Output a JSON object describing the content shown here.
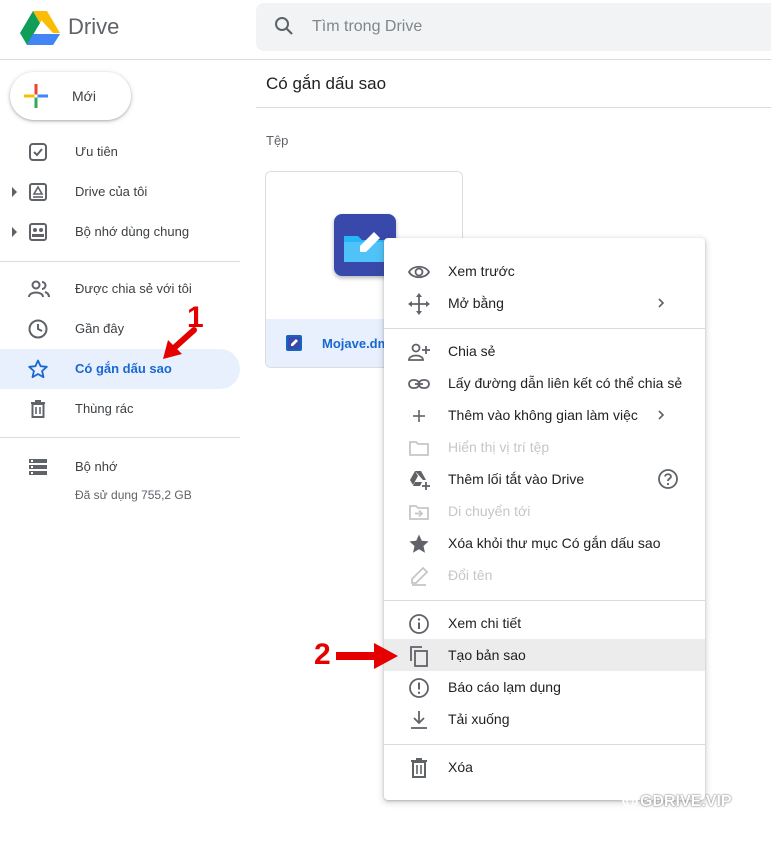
{
  "header": {
    "brand": "Drive",
    "search_placeholder": "Tìm trong Drive"
  },
  "new_button": {
    "label": "Mới"
  },
  "sidebar": {
    "items": [
      {
        "label": "Ưu tiên",
        "icon": "priority-check-icon"
      },
      {
        "label": "Drive của tôi",
        "icon": "my-drive-icon"
      },
      {
        "label": "Bộ nhớ dùng chung",
        "icon": "shared-drives-icon"
      },
      {
        "label": "Được chia sẻ với tôi",
        "icon": "shared-with-me-icon"
      },
      {
        "label": "Gần đây",
        "icon": "clock-icon"
      },
      {
        "label": "Có gắn dấu sao",
        "icon": "star-icon",
        "active": true
      },
      {
        "label": "Thùng rác",
        "icon": "trash-icon"
      }
    ],
    "storage": {
      "label": "Bộ nhớ",
      "used": "Đã sử dụng 755,2 GB"
    }
  },
  "main": {
    "title": "Có gắn dấu sao",
    "section": "Tệp",
    "file": {
      "name": "Mojave.dm"
    }
  },
  "context_menu": {
    "items": [
      {
        "label": "Xem trước",
        "icon": "eye-icon"
      },
      {
        "label": "Mở bằng",
        "icon": "move-arrows-icon",
        "submenu": true
      },
      {
        "label": "Chia sẻ",
        "icon": "add-person-icon"
      },
      {
        "label": "Lấy đường dẫn liên kết có thể chia sẻ",
        "icon": "link-icon"
      },
      {
        "label": "Thêm vào không gian làm việc",
        "icon": "plus-icon",
        "submenu": true
      },
      {
        "label": "Hiển thị vị trí tệp",
        "icon": "folder-icon",
        "disabled": true
      },
      {
        "label": "Thêm lối tắt vào Drive",
        "icon": "drive-shortcut-icon",
        "help": true
      },
      {
        "label": "Di chuyển tới",
        "icon": "move-to-folder-icon",
        "disabled": true
      },
      {
        "label": "Xóa khỏi thư mục Có gắn dấu sao",
        "icon": "star-filled-icon"
      },
      {
        "label": "Đổi tên",
        "icon": "pencil-icon",
        "disabled": true
      },
      {
        "label": "Xem chi tiết",
        "icon": "info-icon"
      },
      {
        "label": "Tạo bản sao",
        "icon": "copy-icon",
        "highlighted": true
      },
      {
        "label": "Báo cáo lạm dụng",
        "icon": "report-icon"
      },
      {
        "label": "Tải xuống",
        "icon": "download-icon"
      },
      {
        "label": "Xóa",
        "icon": "trash-icon"
      }
    ]
  },
  "annotations": {
    "step1": "1",
    "step2": "2",
    "annotation_color": "#e50000"
  },
  "watermark": "GDRIVE.VIP",
  "colors": {
    "active_bg": "#e8f0fe",
    "active_text": "#1967d2",
    "disabled_text": "#c4c7c9"
  }
}
